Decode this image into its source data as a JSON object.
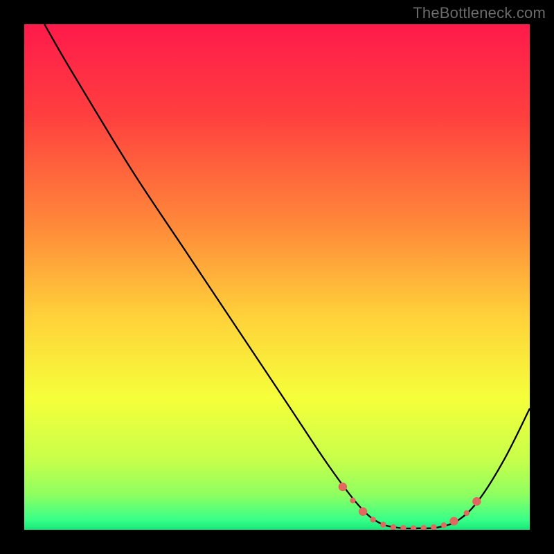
{
  "watermark": "TheBottleneck.com",
  "chart_data": {
    "type": "line",
    "title": "",
    "xlabel": "",
    "ylabel": "",
    "xlim": [
      0,
      100
    ],
    "ylim": [
      0,
      100
    ],
    "gradient_stops": [
      {
        "offset": 0,
        "color": "#ff1a4b"
      },
      {
        "offset": 18,
        "color": "#ff3f3f"
      },
      {
        "offset": 40,
        "color": "#ff8a3a"
      },
      {
        "offset": 58,
        "color": "#ffd23a"
      },
      {
        "offset": 74,
        "color": "#f5ff3a"
      },
      {
        "offset": 86,
        "color": "#c8ff4a"
      },
      {
        "offset": 93,
        "color": "#8fff60"
      },
      {
        "offset": 98,
        "color": "#39ff88"
      },
      {
        "offset": 100,
        "color": "#17e87b"
      }
    ],
    "series": [
      {
        "name": "bottleneck-curve",
        "color": "#000000",
        "points": [
          {
            "x": 4,
            "y": 100
          },
          {
            "x": 8,
            "y": 93
          },
          {
            "x": 14,
            "y": 83
          },
          {
            "x": 22,
            "y": 70
          },
          {
            "x": 32,
            "y": 55
          },
          {
            "x": 42,
            "y": 40
          },
          {
            "x": 52,
            "y": 25
          },
          {
            "x": 60,
            "y": 13
          },
          {
            "x": 66,
            "y": 5
          },
          {
            "x": 70,
            "y": 1.5
          },
          {
            "x": 74,
            "y": 0.4
          },
          {
            "x": 78,
            "y": 0.3
          },
          {
            "x": 82,
            "y": 0.5
          },
          {
            "x": 86,
            "y": 2
          },
          {
            "x": 90,
            "y": 6
          },
          {
            "x": 95,
            "y": 14
          },
          {
            "x": 100,
            "y": 24
          }
        ]
      }
    ],
    "markers": {
      "color": "#e0685e",
      "radius_small": 4.2,
      "radius_large": 6.2,
      "points": [
        {
          "x": 63,
          "y": 8.5,
          "size": "large"
        },
        {
          "x": 65,
          "y": 5.8,
          "size": "small"
        },
        {
          "x": 67,
          "y": 3.6,
          "size": "large"
        },
        {
          "x": 69,
          "y": 2.0,
          "size": "small"
        },
        {
          "x": 71,
          "y": 1.0,
          "size": "small"
        },
        {
          "x": 73,
          "y": 0.5,
          "size": "small"
        },
        {
          "x": 75,
          "y": 0.35,
          "size": "small"
        },
        {
          "x": 77,
          "y": 0.3,
          "size": "small"
        },
        {
          "x": 79,
          "y": 0.35,
          "size": "small"
        },
        {
          "x": 81,
          "y": 0.5,
          "size": "small"
        },
        {
          "x": 83,
          "y": 0.9,
          "size": "small"
        },
        {
          "x": 85,
          "y": 1.7,
          "size": "large"
        },
        {
          "x": 87.5,
          "y": 3.3,
          "size": "small"
        },
        {
          "x": 89.5,
          "y": 5.6,
          "size": "large"
        }
      ]
    }
  }
}
